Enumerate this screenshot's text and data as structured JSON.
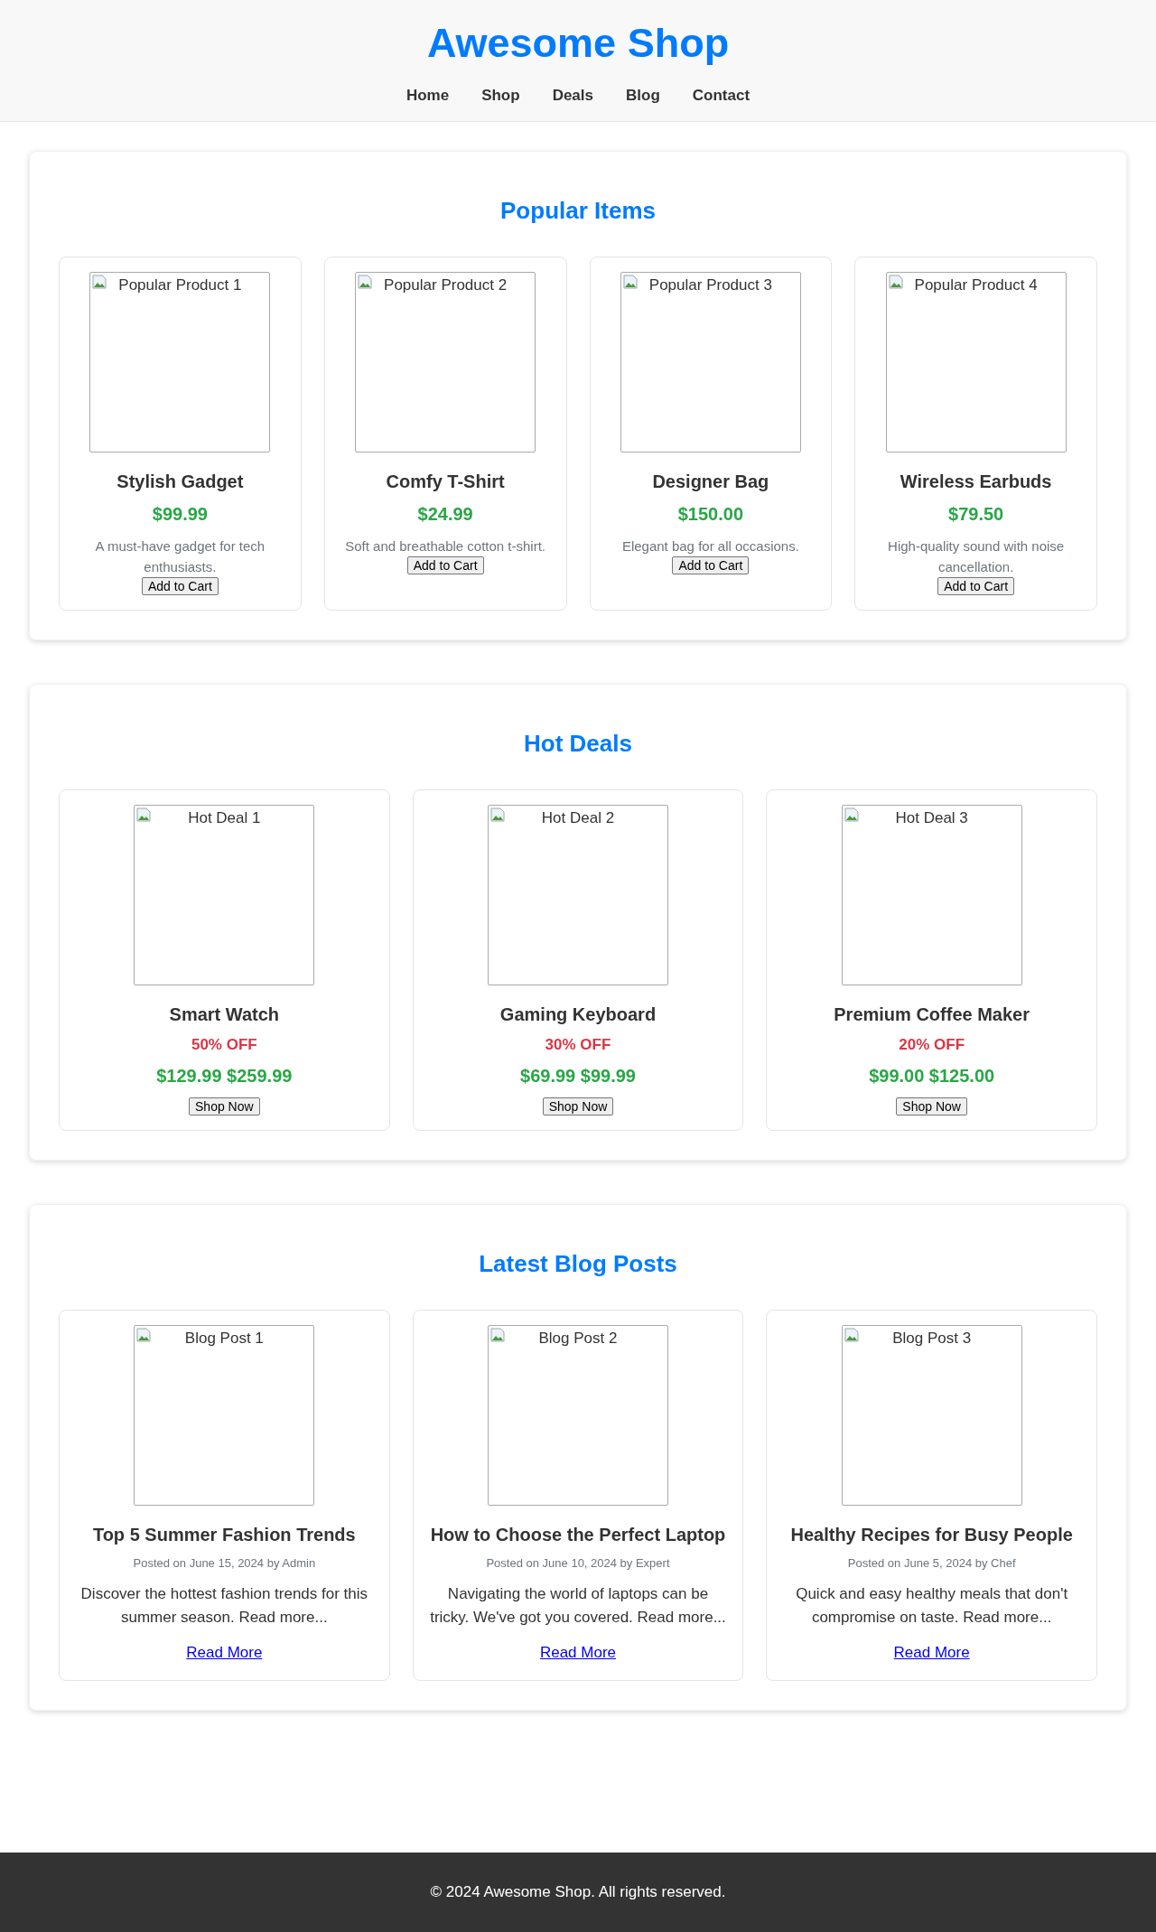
{
  "header": {
    "title": "Awesome Shop",
    "nav": [
      "Home",
      "Shop",
      "Deals",
      "Blog",
      "Contact"
    ]
  },
  "sections": [
    {
      "kind": "products",
      "title": "Popular Items",
      "items": [
        {
          "image_alt": "Popular Product 1",
          "name": "Stylish Gadget",
          "price": "$99.99",
          "description": "A must-have gadget for tech enthusiasts.",
          "button": "Add to Cart"
        },
        {
          "image_alt": "Popular Product 2",
          "name": "Comfy T-Shirt",
          "price": "$24.99",
          "description": "Soft and breathable cotton t-shirt.",
          "button": "Add to Cart"
        },
        {
          "image_alt": "Popular Product 3",
          "name": "Designer Bag",
          "price": "$150.00",
          "description": "Elegant bag for all occasions.",
          "button": "Add to Cart"
        },
        {
          "image_alt": "Popular Product 4",
          "name": "Wireless Earbuds",
          "price": "$79.50",
          "description": "High-quality sound with noise cancellation.",
          "button": "Add to Cart"
        }
      ]
    },
    {
      "kind": "deals",
      "title": "Hot Deals",
      "items": [
        {
          "image_alt": "Hot Deal 1",
          "name": "Smart Watch",
          "discount": "50% OFF",
          "price": "$129.99 $259.99",
          "button": "Shop Now"
        },
        {
          "image_alt": "Hot Deal 2",
          "name": "Gaming Keyboard",
          "discount": "30% OFF",
          "price": "$69.99 $99.99",
          "button": "Shop Now"
        },
        {
          "image_alt": "Hot Deal 3",
          "name": "Premium Coffee Maker",
          "discount": "20% OFF",
          "price": "$99.00 $125.00",
          "button": "Shop Now"
        }
      ]
    },
    {
      "kind": "blog",
      "title": "Latest Blog Posts",
      "items": [
        {
          "image_alt": "Blog Post 1",
          "name": "Top 5 Summer Fashion Trends",
          "meta": "Posted on June 15, 2024 by Admin",
          "excerpt": "Discover the hottest fashion trends for this summer season. Read more...",
          "link": "Read More"
        },
        {
          "image_alt": "Blog Post 2",
          "name": "How to Choose the Perfect Laptop",
          "meta": "Posted on June 10, 2024 by Expert",
          "excerpt": "Navigating the world of laptops can be tricky. We've got you covered. Read more...",
          "link": "Read More"
        },
        {
          "image_alt": "Blog Post 3",
          "name": "Healthy Recipes for Busy People",
          "meta": "Posted on June 5, 2024 by Chef",
          "excerpt": "Quick and easy healthy meals that don't compromise on taste. Read more...",
          "link": "Read More"
        }
      ]
    }
  ],
  "footer": {
    "text": "© 2024 Awesome Shop. All rights reserved."
  }
}
